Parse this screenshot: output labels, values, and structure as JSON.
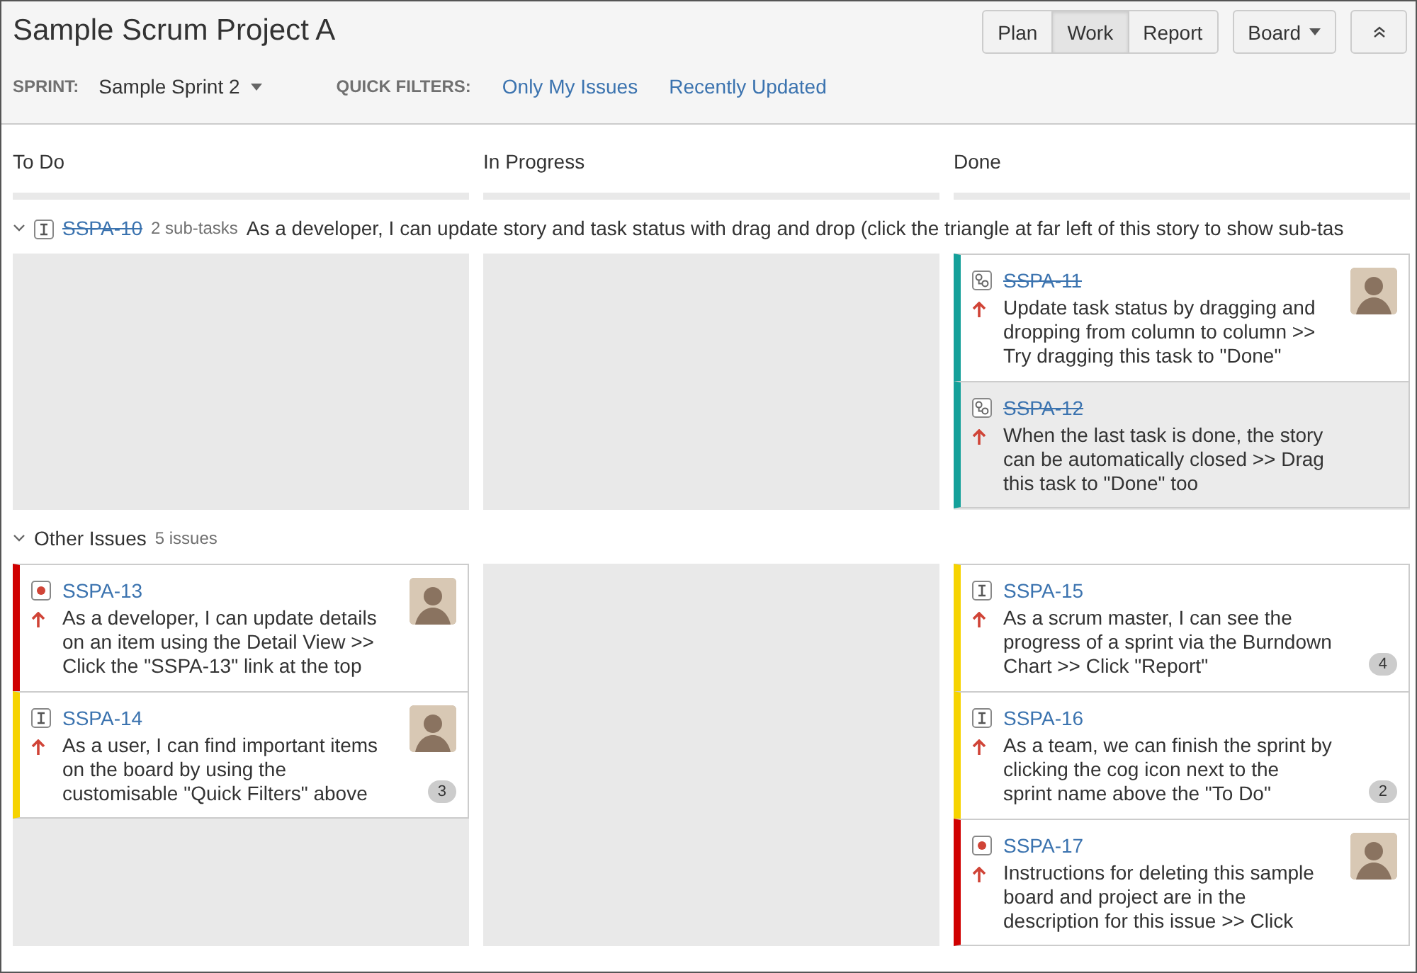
{
  "header": {
    "title": "Sample Scrum Project A",
    "sprint_label": "SPRINT:",
    "sprint": "Sample Sprint 2",
    "quick_filters_label": "QUICK FILTERS:",
    "quick_filters": [
      "Only My Issues",
      "Recently Updated"
    ]
  },
  "view_modes": [
    {
      "label": "Plan",
      "selected": false
    },
    {
      "label": "Work",
      "selected": true
    },
    {
      "label": "Report",
      "selected": false
    }
  ],
  "board_button": "Board",
  "columns": [
    "To Do",
    "In Progress",
    "Done"
  ],
  "swimlanes": [
    {
      "kind": "story",
      "expanded": true,
      "key": "SSPA-10",
      "done": true,
      "count": "2 sub-tasks",
      "summary": "As a developer, I can update story and task status with drag and drop (click the triangle at far left of this story to show sub-tas",
      "columns": [
        [],
        [],
        [
          {
            "key": "SSPA-11",
            "kind": "subtask",
            "done": true,
            "selected": false,
            "color": "#14a09a",
            "summary": "Update task status by dragging and dropping from column to column >> Try dragging this task to \"Done\"",
            "avatar": true
          },
          {
            "key": "SSPA-12",
            "kind": "subtask",
            "done": true,
            "selected": true,
            "color": "#14a09a",
            "summary": "When the last task is done, the story can be automatically closed >> Drag this task to \"Done\" too",
            "avatar": false
          }
        ]
      ]
    },
    {
      "kind": "group",
      "expanded": true,
      "title": "Other Issues",
      "count": "5 issues",
      "columns": [
        [
          {
            "key": "SSPA-13",
            "kind": "bug",
            "done": false,
            "selected": false,
            "color": "#d00000",
            "summary": "As a developer, I can update details on an item using the Detail View >> Click the \"SSPA-13\" link at the top",
            "avatar": true
          },
          {
            "key": "SSPA-14",
            "kind": "story",
            "done": false,
            "selected": false,
            "color": "#f6d300",
            "summary": "As a user, I can find important items on the board by using the customisable \"Quick Filters\" above",
            "avatar": true,
            "badge": "3"
          }
        ],
        [],
        [
          {
            "key": "SSPA-15",
            "kind": "story",
            "done": false,
            "selected": false,
            "color": "#f6d300",
            "summary": "As a scrum master, I can see the progress of a sprint via the Burndown Chart >> Click \"Report\"",
            "avatar": false,
            "badge": "4"
          },
          {
            "key": "SSPA-16",
            "kind": "story",
            "done": false,
            "selected": false,
            "color": "#f6d300",
            "summary": "As a team, we can finish the sprint by clicking the cog icon next to the sprint name above the \"To Do\"",
            "avatar": false,
            "badge": "2"
          },
          {
            "key": "SSPA-17",
            "kind": "bug",
            "done": false,
            "selected": false,
            "color": "#d00000",
            "summary": "Instructions for deleting this sample board and project are in the description for this issue >> Click",
            "avatar": true
          }
        ]
      ]
    }
  ]
}
